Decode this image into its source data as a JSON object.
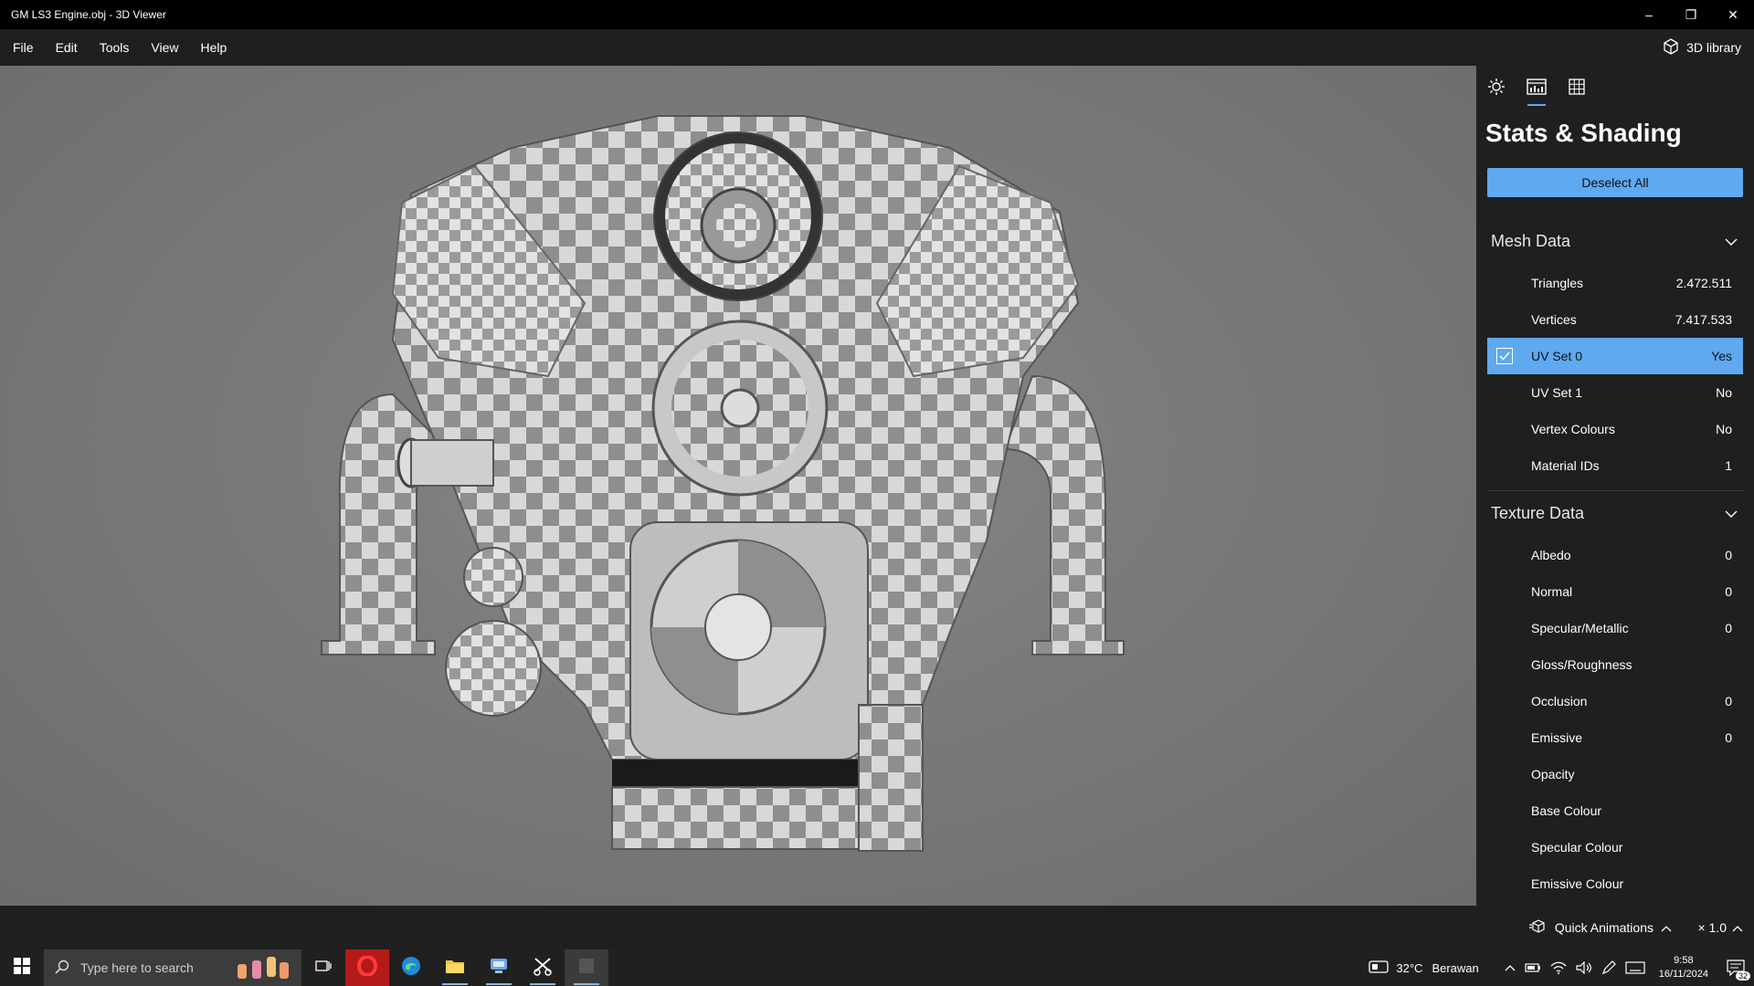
{
  "window": {
    "title": "GM LS3 Engine.obj - 3D Viewer",
    "minimize_glyph": "–",
    "restore_glyph": "❐",
    "close_glyph": "✕"
  },
  "menu": {
    "items": [
      "File",
      "Edit",
      "Tools",
      "View",
      "Help"
    ],
    "library_label": "3D library"
  },
  "panel": {
    "tab_icons": [
      "sun-icon",
      "stats-icon",
      "grid-icon"
    ],
    "active_tab": 1,
    "title": "Stats & Shading",
    "deselect_label": "Deselect All",
    "mesh_section": {
      "title": "Mesh Data",
      "rows": [
        {
          "label": "Triangles",
          "value": "2.472.511"
        },
        {
          "label": "Vertices",
          "value": "7.417.533"
        },
        {
          "label": "UV Set 0",
          "value": "Yes",
          "selected": true
        },
        {
          "label": "UV Set 1",
          "value": "No"
        },
        {
          "label": "Vertex Colours",
          "value": "No"
        },
        {
          "label": "Material IDs",
          "value": "1"
        }
      ]
    },
    "texture_section": {
      "title": "Texture Data",
      "rows": [
        {
          "label": "Albedo",
          "value": "0"
        },
        {
          "label": "Normal",
          "value": "0"
        },
        {
          "label": "Specular/Metallic",
          "value": "0"
        },
        {
          "label": "Gloss/Roughness",
          "value": ""
        },
        {
          "label": "Occlusion",
          "value": "0"
        },
        {
          "label": "Emissive",
          "value": "0"
        },
        {
          "label": "Opacity",
          "value": ""
        },
        {
          "label": "Base Colour",
          "value": ""
        },
        {
          "label": "Specular Colour",
          "value": ""
        },
        {
          "label": "Emissive Colour",
          "value": ""
        }
      ]
    }
  },
  "bottom": {
    "quick_animations_label": "Quick Animations",
    "speed_label": "× 1.0"
  },
  "taskbar": {
    "search_placeholder": "Type here to search",
    "weather_temp": "32°C",
    "weather_text": "Berawan",
    "time": "9:58",
    "date": "16/11/2024",
    "notification_count": "32"
  },
  "colors": {
    "accent": "#5ea9f0",
    "panel_bg": "#1f1f1f",
    "viewport_bg": "#7b7b7b"
  }
}
